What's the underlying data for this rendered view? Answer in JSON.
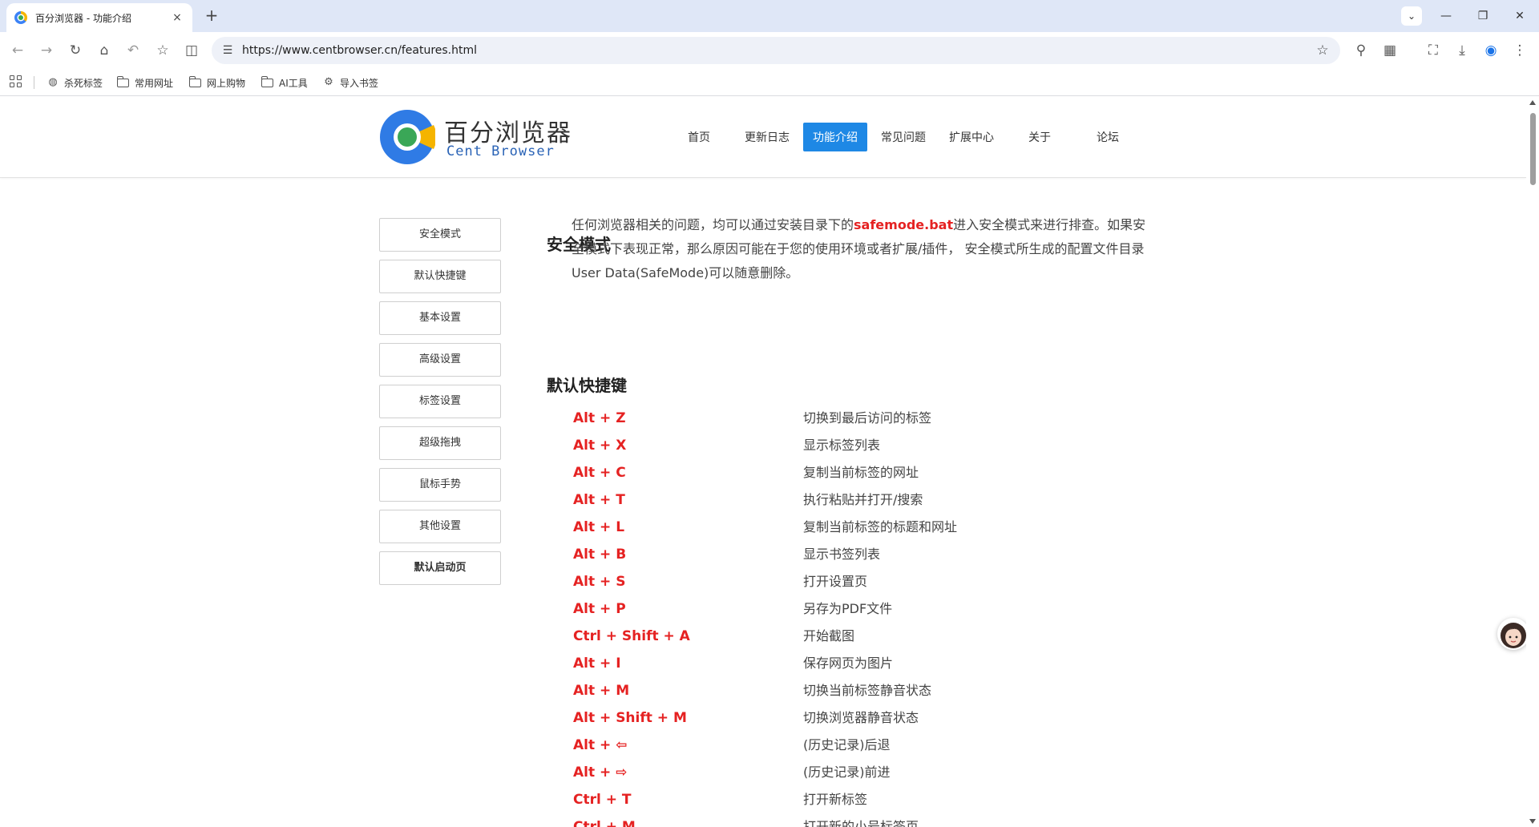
{
  "browser": {
    "tab": {
      "title": "百分浏览器 - 功能介绍",
      "close": "×"
    },
    "new_tab": "+",
    "window_controls": {
      "tab_search": "⌄",
      "minimize": "—",
      "restore": "❐",
      "close": "✕"
    },
    "toolbar": {
      "back": "←",
      "forward": "→",
      "reload": "↻",
      "home": "⌂",
      "undo": "↶",
      "bookmark_star": "☆",
      "reading_mode": "◫",
      "url": "https://www.centbrowser.cn/features.html",
      "omni_star": "☆",
      "search": "⚲",
      "qr": "▦",
      "crop": "⛶",
      "download": "⤓",
      "profile": "◉",
      "menu": "⋮"
    },
    "bookmarks": [
      {
        "label": "杀死标签",
        "icon": "globe-icon",
        "glyph": "◍"
      },
      {
        "label": "常用网址",
        "icon": "folder-icon"
      },
      {
        "label": "网上购物",
        "icon": "folder-icon"
      },
      {
        "label": "AI工具",
        "icon": "folder-icon"
      },
      {
        "label": "导入书签",
        "icon": "gear-icon",
        "glyph": "⚙"
      }
    ]
  },
  "site": {
    "logo": {
      "name_cn": "百分浏览器",
      "name_en": "Cent Browser"
    },
    "nav": [
      "首页",
      "更新日志",
      "功能介绍",
      "常见问题",
      "扩展中心",
      "关于",
      "论坛"
    ],
    "active_nav": "功能介绍",
    "sidebar": [
      "安全模式",
      "默认快捷键",
      "基本设置",
      "高级设置",
      "标签设置",
      "超级拖拽",
      "鼠标手势",
      "其他设置",
      "默认启动页"
    ],
    "safe_mode": {
      "title": "安全模式",
      "text_before": "任何浏览器相关的问题，均可以通过安装目录下的",
      "highlight": "safemode.bat",
      "text_after": "进入安全模式来进行排查。如果安全模式下表现正常，那么原因可能在于您的使用环境或者扩展/插件， 安全模式所生成的配置文件目录User Data(SafeMode)可以随意删除。"
    },
    "shortcuts": {
      "title": "默认快捷键",
      "rows": [
        {
          "key": "Alt + Z",
          "desc": "切换到最后访问的标签"
        },
        {
          "key": "Alt + X",
          "desc": "显示标签列表"
        },
        {
          "key": "Alt + C",
          "desc": "复制当前标签的网址"
        },
        {
          "key": "Alt + T",
          "desc": "执行粘贴并打开/搜索"
        },
        {
          "key": "Alt + L",
          "desc": "复制当前标签的标题和网址"
        },
        {
          "key": "Alt + B",
          "desc": "显示书签列表"
        },
        {
          "key": "Alt + S",
          "desc": "打开设置页"
        },
        {
          "key": "Alt + P",
          "desc": "另存为PDF文件"
        },
        {
          "key": "Ctrl + Shift + A",
          "desc": "开始截图"
        },
        {
          "key": "Alt + I",
          "desc": "保存网页为图片"
        },
        {
          "key": "Alt + M",
          "desc": "切换当前标签静音状态"
        },
        {
          "key": "Alt + Shift + M",
          "desc": "切换浏览器静音状态"
        },
        {
          "key": "Alt + ⇦",
          "desc": "(历史记录)后退"
        },
        {
          "key": "Alt + ⇨",
          "desc": "(历史记录)前进"
        },
        {
          "key": "Ctrl + T",
          "desc": "打开新标签"
        },
        {
          "key": "Ctrl + M",
          "desc": "打开新的小号标签页"
        }
      ]
    }
  },
  "colors": {
    "accent": "#1e88e5",
    "highlight": "#e52222",
    "chrome_bg": "#dfe7f7"
  }
}
